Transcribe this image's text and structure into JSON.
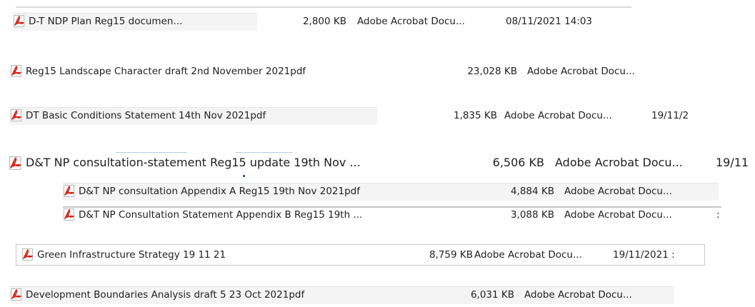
{
  "files": [
    {
      "name": "D-T NDP Plan Reg15 documen...",
      "size": "2,800 KB",
      "type": "Adobe Acrobat Docu...",
      "date": "08/11/2021 14:03",
      "icon": "pdf-file-icon"
    },
    {
      "name": "Reg15 Landscape Character draft  2nd November  2021pdf",
      "size": "23,028 KB",
      "type": "Adobe Acrobat Docu...",
      "date": "",
      "icon": "pdf-file-icon"
    },
    {
      "name": "DT Basic Conditions Statement 14th Nov  2021pdf",
      "size": "1,835 KB",
      "type": "Adobe Acrobat Docu...",
      "date": "19/11/2",
      "icon": "pdf-file-icon"
    },
    {
      "name": "D&T NP consultation-statement Reg15  update  19th Nov ...",
      "size": "6,506 KB",
      "type": "Adobe Acrobat Docu...",
      "date": "19/11",
      "icon": "pdf-file-icon"
    },
    {
      "name": "D&T NP consultation Appendix A Reg15  19th Nov 2021pdf",
      "size": "4,884 KB",
      "type": "Adobe Acrobat Docu...",
      "date": "",
      "icon": "pdf-file-icon"
    },
    {
      "name": "D&T NP Consultation Statement Appendix B Reg15  19th ...",
      "size": "3,088 KB",
      "type": "Adobe Acrobat Docu...",
      "date": ":",
      "icon": "pdf-file-icon"
    },
    {
      "name": "Green Infrastructure Strategy 19 11 21",
      "size": "8,759 KB",
      "type": "Adobe Acrobat Docu...",
      "date": "19/11/2021 :",
      "icon": "pdf-file-icon"
    },
    {
      "name": "Development Boundaries Analysis draft 5 23 Oct 2021pdf",
      "size": "6,031 KB",
      "type": "Adobe Acrobat Docu...",
      "date": "",
      "icon": "pdf-file-icon"
    }
  ],
  "colors": {
    "pdf_icon_red": "#d42a1c",
    "text": "#1f1f1f"
  }
}
